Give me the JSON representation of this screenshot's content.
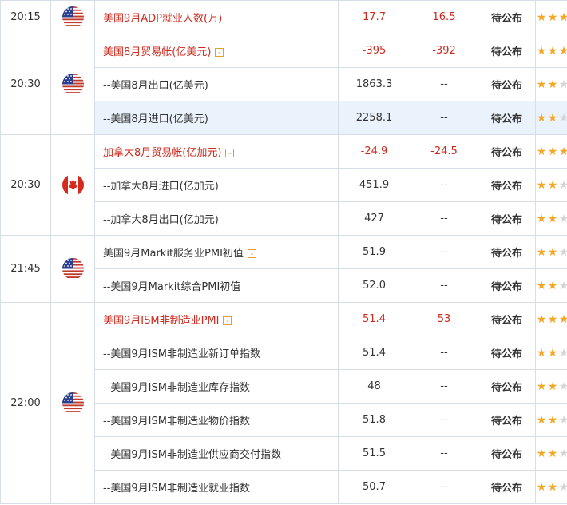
{
  "colors": {
    "accent_red": "#cc2a1e",
    "star_on": "#f5a623",
    "star_off": "#d5d5d5",
    "highlight_row": "#eaf2fb"
  },
  "toggle_symbol": "-",
  "star_glyph": "★",
  "groups": [
    {
      "time": "20:15",
      "flag": "us-flag-icon",
      "rows": [
        {
          "name": "美国9月ADP就业人数(万)",
          "main": true,
          "toggle": false,
          "actual": "17.7",
          "forecast": "16.5",
          "previous": "待公布",
          "stars": 3
        }
      ]
    },
    {
      "time": "20:30",
      "flag": "us-flag-icon",
      "rows": [
        {
          "name": "美国8月贸易帐(亿美元)",
          "main": true,
          "toggle": true,
          "actual": "-395",
          "forecast": "-392",
          "previous": "待公布",
          "stars": 3
        },
        {
          "name": "--美国8月出口(亿美元)",
          "main": false,
          "toggle": false,
          "actual": "1863.3",
          "forecast": "--",
          "previous": "待公布",
          "stars": 2
        },
        {
          "name": "--美国8月进口(亿美元)",
          "main": false,
          "toggle": false,
          "actual": "2258.1",
          "forecast": "--",
          "previous": "待公布",
          "stars": 2,
          "highlight": true
        }
      ]
    },
    {
      "time": "20:30",
      "flag": "canada-flag-icon",
      "rows": [
        {
          "name": "加拿大8月贸易帐(亿加元)",
          "main": true,
          "toggle": true,
          "actual": "-24.9",
          "forecast": "-24.5",
          "previous": "待公布",
          "stars": 3
        },
        {
          "name": "--加拿大8月进口(亿加元)",
          "main": false,
          "toggle": false,
          "actual": "451.9",
          "forecast": "--",
          "previous": "待公布",
          "stars": 2
        },
        {
          "name": "--加拿大8月出口(亿加元)",
          "main": false,
          "toggle": false,
          "actual": "427",
          "forecast": "--",
          "previous": "待公布",
          "stars": 2
        }
      ]
    },
    {
      "time": "21:45",
      "flag": "us-flag-icon",
      "rows": [
        {
          "name": "美国9月Markit服务业PMI初值",
          "main": false,
          "toggle": true,
          "actual": "51.9",
          "forecast": "--",
          "previous": "待公布",
          "stars": 2
        },
        {
          "name": "--美国9月Markit综合PMI初值",
          "main": false,
          "toggle": false,
          "actual": "52.0",
          "forecast": "--",
          "previous": "待公布",
          "stars": 2
        }
      ]
    },
    {
      "time": "22:00",
      "flag": "us-flag-icon",
      "rows": [
        {
          "name": "美国9月ISM非制造业PMI",
          "main": true,
          "toggle": true,
          "actual": "51.4",
          "forecast": "53",
          "previous": "待公布",
          "stars": 3
        },
        {
          "name": "--美国9月ISM非制造业新订单指数",
          "main": false,
          "toggle": false,
          "actual": "51.4",
          "forecast": "--",
          "previous": "待公布",
          "stars": 2
        },
        {
          "name": "--美国9月ISM非制造业库存指数",
          "main": false,
          "toggle": false,
          "actual": "48",
          "forecast": "--",
          "previous": "待公布",
          "stars": 2
        },
        {
          "name": "--美国9月ISM非制造业物价指数",
          "main": false,
          "toggle": false,
          "actual": "51.8",
          "forecast": "--",
          "previous": "待公布",
          "stars": 2
        },
        {
          "name": "--美国9月ISM非制造业供应商交付指数",
          "main": false,
          "toggle": false,
          "actual": "51.5",
          "forecast": "--",
          "previous": "待公布",
          "stars": 2
        },
        {
          "name": "--美国9月ISM非制造业就业指数",
          "main": false,
          "toggle": false,
          "actual": "50.7",
          "forecast": "--",
          "previous": "待公布",
          "stars": 2
        }
      ]
    }
  ]
}
